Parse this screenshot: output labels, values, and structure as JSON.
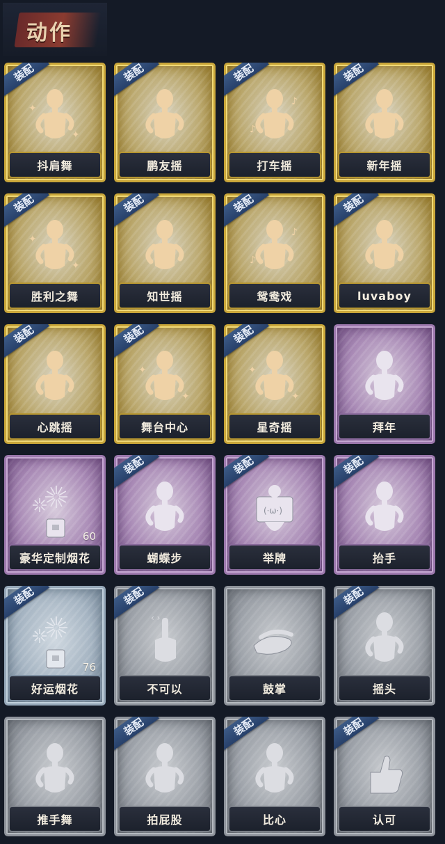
{
  "header": {
    "title": "动作"
  },
  "badge_label": "装配",
  "emotes": [
    {
      "label": "抖肩舞",
      "tier": "gold",
      "equipped": true,
      "icon": "dancer-shrug-icon"
    },
    {
      "label": "鹏友摇",
      "tier": "gold",
      "equipped": true,
      "icon": "dancer-point-icon"
    },
    {
      "label": "打车摇",
      "tier": "gold",
      "equipped": true,
      "icon": "dancer-music-icon"
    },
    {
      "label": "新年摇",
      "tier": "gold",
      "equipped": true,
      "icon": "dancer-clap-icon"
    },
    {
      "label": "胜利之舞",
      "tier": "gold",
      "equipped": true,
      "icon": "dancer-victory-icon"
    },
    {
      "label": "知世摇",
      "tier": "gold",
      "equipped": true,
      "icon": "dancer-sway-icon"
    },
    {
      "label": "鸳鸯戏",
      "tier": "gold",
      "equipped": true,
      "icon": "dancer-music-icon"
    },
    {
      "label": "luvaboy",
      "tier": "gold",
      "equipped": true,
      "icon": "dancer-cross-icon"
    },
    {
      "label": "心跳摇",
      "tier": "gold",
      "equipped": true,
      "icon": "dancer-heartbeat-icon"
    },
    {
      "label": "舞台中心",
      "tier": "gold",
      "equipped": true,
      "icon": "dancer-stage-icon"
    },
    {
      "label": "星奇摇",
      "tier": "gold",
      "equipped": true,
      "icon": "dancer-star-icon"
    },
    {
      "label": "拜年",
      "tier": "purple",
      "equipped": false,
      "icon": "bow-greeting-icon"
    },
    {
      "label": "豪华定制烟花",
      "tier": "purple",
      "equipped": false,
      "icon": "fireworks-box-icon",
      "count": "60"
    },
    {
      "label": "蝴蝶步",
      "tier": "purple",
      "equipped": true,
      "icon": "dancer-dab-icon"
    },
    {
      "label": "举牌",
      "tier": "purple",
      "equipped": true,
      "icon": "hold-sign-icon"
    },
    {
      "label": "抬手",
      "tier": "purple",
      "equipped": true,
      "icon": "raise-hand-icon"
    },
    {
      "label": "好运烟花",
      "tier": "blue",
      "equipped": true,
      "icon": "firework-canister-icon",
      "count": "76"
    },
    {
      "label": "不可以",
      "tier": "grey",
      "equipped": true,
      "icon": "finger-wag-icon"
    },
    {
      "label": "鼓掌",
      "tier": "grey",
      "equipped": false,
      "icon": "clap-hands-icon"
    },
    {
      "label": "摇头",
      "tier": "grey",
      "equipped": true,
      "icon": "shake-head-icon"
    },
    {
      "label": "推手舞",
      "tier": "grey",
      "equipped": false,
      "icon": "push-hands-icon"
    },
    {
      "label": "拍屁股",
      "tier": "grey",
      "equipped": true,
      "icon": "pat-butt-icon"
    },
    {
      "label": "比心",
      "tier": "grey",
      "equipped": true,
      "icon": "finger-heart-icon"
    },
    {
      "label": "认可",
      "tier": "grey",
      "equipped": true,
      "icon": "thumbs-up-icon"
    }
  ],
  "colors": {
    "gold_figure": "#efd2a6",
    "purple_figure": "#e6e2ea",
    "grey_figure": "#dcdde2",
    "badge": "#2f4a78",
    "background": "#141a26"
  }
}
